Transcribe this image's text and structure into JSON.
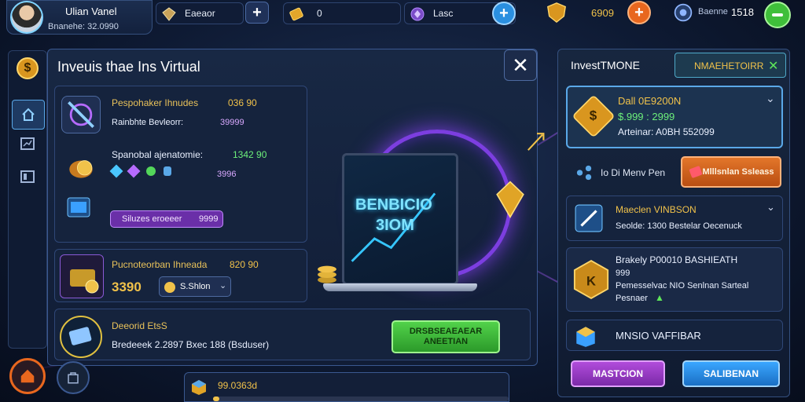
{
  "profile": {
    "name": "Ulian Vanel",
    "subtitle": "Bnanehe: 32.0990"
  },
  "resources": {
    "gems_label": "Eaeaor",
    "gold_value": "0",
    "crystal_label": "Lasc",
    "shield_value": "6909",
    "energy_label": "Baenne",
    "energy_value": "1518"
  },
  "dialog": {
    "title": "Inveuis thae Ins Virtual",
    "close_glyph": "✕",
    "items": [
      {
        "name": "Pespohaker Ihnudes",
        "value": "036 90",
        "sub": "Rainbhte Bevleorr:",
        "sub_value": "39999"
      },
      {
        "name": "Spanobal ajenatomie:",
        "value": "1342 90",
        "sub_value": "3996",
        "badge_label": "Siluzes eroeeer",
        "badge_value": "9999"
      },
      {
        "name": "Pucnoteorban Ihneada",
        "value": "820 90",
        "price": "3390",
        "select_value": "S.Shlon"
      },
      {
        "name": "Deeorid EtsS",
        "desc": "Bredeeek 2.2897 Bxec 188 (Bsduser)",
        "action": "DRSBSEAEAEAR ANEETIAN"
      }
    ],
    "promo_line1": "BENBICIO",
    "promo_line2": "3IOM"
  },
  "sidenav": {
    "icons": [
      "dollar-icon",
      "home-icon",
      "chart-icon",
      "card-icon"
    ]
  },
  "right_panel": {
    "title": "InvestTMONE",
    "tab_label": "NMAEHETOIRR",
    "tab_close": "✕",
    "featured": {
      "title": "Dall 0E9200N",
      "value": "$.999 : 2999",
      "sub": "Arteinar: A0BH 552099"
    },
    "row2_label": "Io Di Menv Pen",
    "row2_button": "Mlllsnlan Ssleass",
    "list": [
      {
        "title": "Maeclen VINBSON",
        "sub": "Seolde: 1300 Bestelar Oecenuck"
      },
      {
        "title": "Brakely P00010 BASHIEATH",
        "line2": "999",
        "line3": "Pemesselvac NIO Senlnan Sarteal",
        "line4": "Pesnaer"
      },
      {
        "title": "MNSIO VAFFIBAR"
      }
    ],
    "btn_left": "MASTCION",
    "btn_right": "SALIBENAN"
  },
  "bottom": {
    "progress_label": "99.0363d",
    "progress_fraction": 0.02
  },
  "colors": {
    "accent_gold": "#f1c24a",
    "accent_green": "#3fbf3a",
    "accent_purple": "#9b37c6",
    "accent_blue": "#2a8fe0",
    "accent_orange": "#e8671e"
  }
}
